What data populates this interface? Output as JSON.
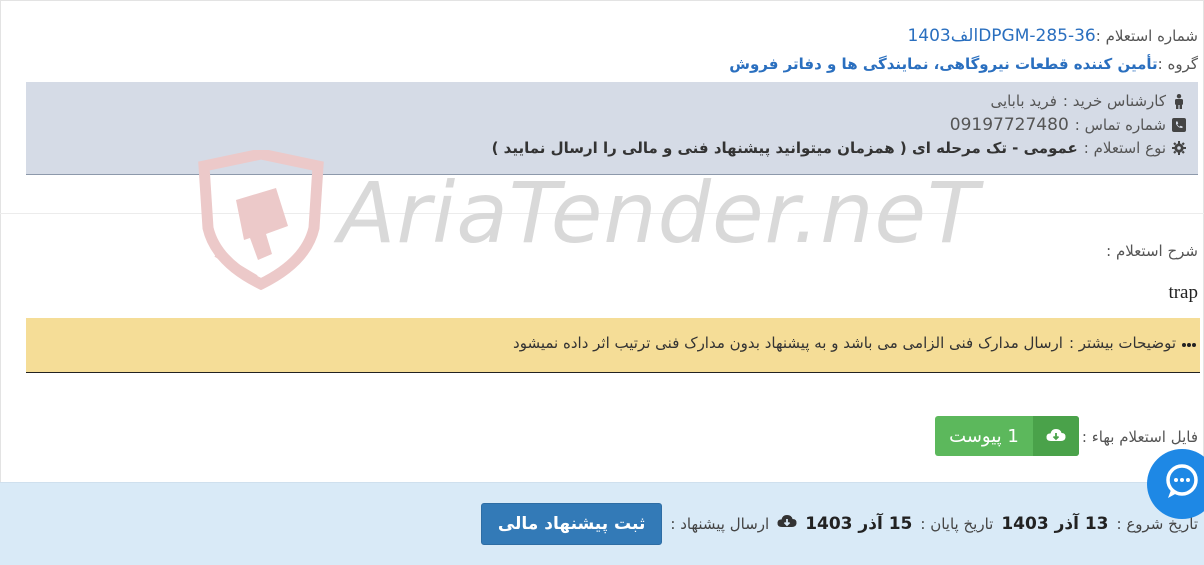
{
  "header": {
    "tender_number_label": "شماره استعلام :",
    "tender_number_value": "DPGM-285-36الف1403",
    "group_label": "گروه :",
    "group_value": "تأمین کننده قطعات نیروگاهی، نمایندگی ها و دفاتر فروش"
  },
  "info": {
    "expert_label": "کارشناس خرید :",
    "expert_value": "فرید بابایی",
    "phone_label": "شماره تماس :",
    "phone_value": "09197727480",
    "type_label": "نوع استعلام :",
    "type_value": "عمومی - تک مرحله ای ( همزمان میتوانید پیشنهاد فنی و مالی را ارسال نمایید )"
  },
  "watermark": {
    "text": "AriaTender.neT"
  },
  "description": {
    "label": "شرح استعلام :",
    "value": "trap"
  },
  "notice": {
    "label": "توضیحات بیشتر :",
    "text": "ارسال مدارک فنی الزامی می باشد و به پیشنهاد بدون مدارک فنی ترتیب اثر داده نمیشود"
  },
  "file": {
    "label": "فایل استعلام بهاء :",
    "button_label": "1 پیوست"
  },
  "footer": {
    "start_label": "تاریخ شروع :",
    "start_value": "13 آذر 1403",
    "end_label": "تاریخ پایان :",
    "end_value": "15 آذر 1403",
    "send_label": "ارسال پیشنهاد :",
    "submit_label": "ثبت پیشنهاد مالی"
  },
  "colors": {
    "accent_blue": "#2a6fbf",
    "info_bg": "#d5dbe6",
    "notice_bg": "#f5dd97",
    "download_green": "#5cb85c",
    "submit_blue": "#337ab7",
    "footer_bg": "#d9eaf7",
    "chat_blue": "#1e88e5"
  },
  "icons": {
    "expert": "person-icon",
    "phone": "phone-icon",
    "type": "gear-icon",
    "notice": "ellipsis-icon",
    "download": "cloud-download-icon",
    "chat": "chat-bubble-icon"
  }
}
